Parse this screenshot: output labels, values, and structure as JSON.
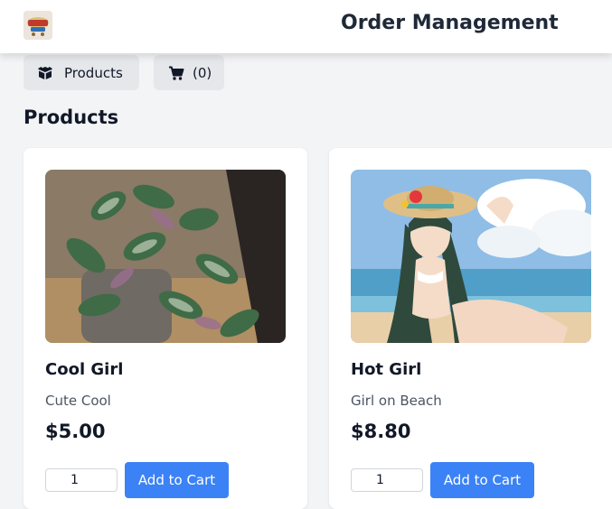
{
  "header": {
    "title": "Order Management",
    "logo_icon": "shop-logo-icon"
  },
  "nav": {
    "products_label": "Products",
    "products_icon": "box-icon",
    "cart_label": "(0)",
    "cart_icon": "cart-icon"
  },
  "section": {
    "title": "Products"
  },
  "products": [
    {
      "name": "Cool Girl",
      "description": "Cute Cool",
      "price": "$5.00",
      "quantity": "1",
      "add_label": "Add to Cart"
    },
    {
      "name": "Hot Girl",
      "description": "Girl on Beach",
      "price": "$8.80",
      "quantity": "1",
      "add_label": "Add to Cart"
    }
  ],
  "colors": {
    "accent": "#3b82f6",
    "background": "#f3f4f6",
    "nav_button": "#e5e7eb"
  }
}
